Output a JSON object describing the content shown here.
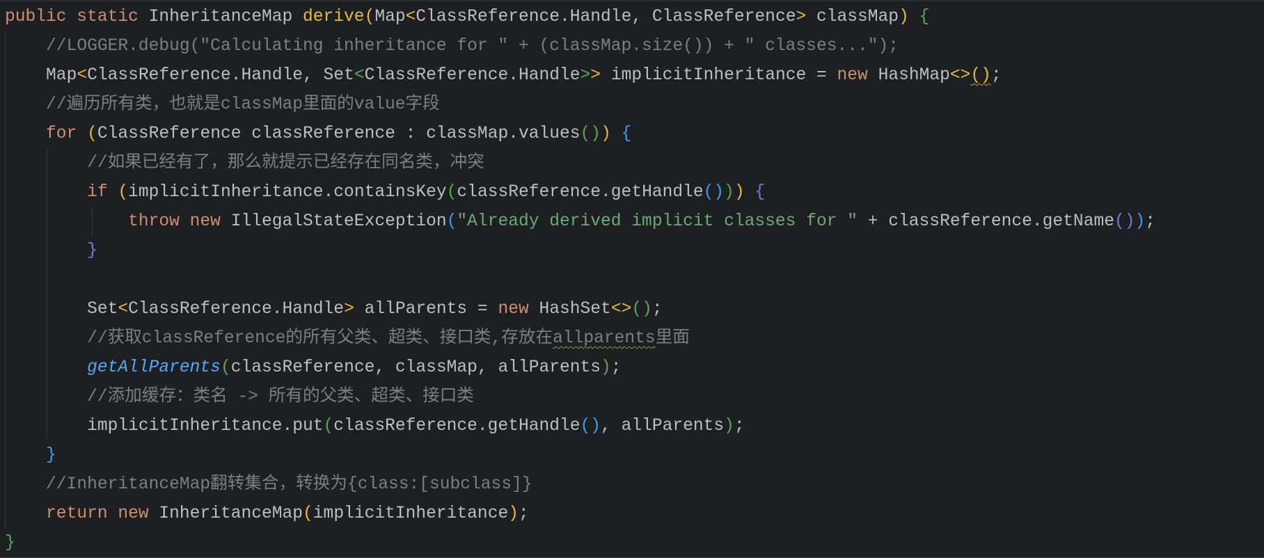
{
  "editor": {
    "language": "Java",
    "lines": [
      [
        [
          "kw",
          "public static "
        ],
        [
          "cls",
          "InheritanceMap "
        ],
        [
          "p1fn",
          "derive"
        ],
        [
          "p1",
          "("
        ],
        [
          "cls",
          "Map"
        ],
        [
          "p1",
          "<"
        ],
        [
          "cls",
          "ClassReference.Handle, ClassReference"
        ],
        [
          "p1",
          ">"
        ],
        [
          "cls",
          " classMap"
        ],
        [
          "p1",
          ")"
        ],
        [
          "cls",
          " "
        ],
        [
          "p2",
          "{"
        ]
      ],
      [
        [
          "ind1",
          ""
        ],
        [
          "cm",
          "//LOGGER.debug(\"Calculating inheritance for \" + (classMap.size()) + \" classes...\");"
        ]
      ],
      [
        [
          "ind1",
          ""
        ],
        [
          "cls",
          "Map"
        ],
        [
          "p1",
          "<"
        ],
        [
          "cls",
          "ClassReference.Handle, Set"
        ],
        [
          "p2",
          "<"
        ],
        [
          "cls",
          "ClassReference.Handle"
        ],
        [
          "p2",
          ">"
        ],
        [
          "p1",
          ">"
        ],
        [
          "cls",
          " implicitInheritance = "
        ],
        [
          "kw",
          "new "
        ],
        [
          "cls",
          "HashMap"
        ],
        [
          "p1",
          "<>"
        ],
        [
          "sq",
          "()"
        ],
        [
          "cls",
          ";"
        ]
      ],
      [
        [
          "ind1",
          ""
        ],
        [
          "cm",
          "//遍历所有类，也就是classMap里面的value字段"
        ]
      ],
      [
        [
          "ind1",
          ""
        ],
        [
          "kw",
          "for "
        ],
        [
          "p1",
          "("
        ],
        [
          "cls",
          "ClassReference classReference : classMap.values"
        ],
        [
          "p2",
          "()"
        ],
        [
          "p1",
          ")"
        ],
        [
          "cls",
          " "
        ],
        [
          "p3",
          "{"
        ]
      ],
      [
        [
          "ind2",
          ""
        ],
        [
          "cm",
          "//如果已经有了，那么就提示已经存在同名类，冲突"
        ]
      ],
      [
        [
          "ind2",
          ""
        ],
        [
          "kw",
          "if "
        ],
        [
          "p1",
          "("
        ],
        [
          "cls",
          "implicitInheritance.containsKey"
        ],
        [
          "p2",
          "("
        ],
        [
          "cls",
          "classReference.getHandle"
        ],
        [
          "p3",
          "()"
        ],
        [
          "p2",
          ")"
        ],
        [
          "p1",
          ")"
        ],
        [
          "cls",
          " "
        ],
        [
          "p4",
          "{"
        ]
      ],
      [
        [
          "ind3",
          ""
        ],
        [
          "kw",
          "throw new "
        ],
        [
          "cls",
          "IllegalStateException"
        ],
        [
          "p3",
          "("
        ],
        [
          "str",
          "\"Already derived implicit classes for \""
        ],
        [
          "cls",
          " + classReference.getName"
        ],
        [
          "p4",
          "()"
        ],
        [
          "p3",
          ")"
        ],
        [
          "cls",
          ";"
        ]
      ],
      [
        [
          "ind2",
          ""
        ],
        [
          "p4",
          "}"
        ]
      ],
      [],
      [
        [
          "ind2",
          ""
        ],
        [
          "cls",
          "Set"
        ],
        [
          "p1",
          "<"
        ],
        [
          "cls",
          "ClassReference.Handle"
        ],
        [
          "p1",
          ">"
        ],
        [
          "cls",
          " allParents = "
        ],
        [
          "kw",
          "new "
        ],
        [
          "cls",
          "HashSet"
        ],
        [
          "p1",
          "<>"
        ],
        [
          "p2",
          "()"
        ],
        [
          "cls",
          ";"
        ]
      ],
      [
        [
          "ind2",
          ""
        ],
        [
          "cm",
          "//获取classReference的所有父类、超类、接口类,存放在"
        ],
        [
          "cmsq",
          "allparents"
        ],
        [
          "cm",
          "里面"
        ]
      ],
      [
        [
          "ind2",
          ""
        ],
        [
          "it",
          "getAllParents"
        ],
        [
          "p2",
          "("
        ],
        [
          "cls",
          "classReference, classMap, allParents"
        ],
        [
          "p2",
          ")"
        ],
        [
          "cls",
          ";"
        ]
      ],
      [
        [
          "ind2",
          ""
        ],
        [
          "cm",
          "//添加缓存：类名 -> 所有的父类、超类、接口类"
        ]
      ],
      [
        [
          "ind2",
          ""
        ],
        [
          "cls",
          "implicitInheritance.put"
        ],
        [
          "p2",
          "("
        ],
        [
          "cls",
          "classReference.getHandle"
        ],
        [
          "p3",
          "()"
        ],
        [
          "cls",
          ", allParents"
        ],
        [
          "p2",
          ")"
        ],
        [
          "cls",
          ";"
        ]
      ],
      [
        [
          "ind1",
          ""
        ],
        [
          "p3",
          "}"
        ]
      ],
      [
        [
          "ind1",
          ""
        ],
        [
          "cm",
          "//InheritanceMap翻转集合，转换为{class:[subclass]}"
        ]
      ],
      [
        [
          "ind1",
          ""
        ],
        [
          "kw",
          "return new "
        ],
        [
          "cls",
          "InheritanceMap"
        ],
        [
          "p1",
          "("
        ],
        [
          "cls",
          "implicitInheritance"
        ],
        [
          "p1",
          ")"
        ],
        [
          "cls",
          ";"
        ]
      ],
      [
        [
          "p2",
          "}"
        ]
      ]
    ]
  },
  "colors": {
    "background": "#1e1f22",
    "keyword": "#cf8e6d",
    "function": "#56a8f5",
    "string": "#6aab73",
    "comment": "#7a7e85",
    "text": "#bcbec4",
    "bracket_level1": "#e8ba36",
    "bracket_level2": "#54a857",
    "bracket_level3": "#359ff4",
    "bracket_level4": "#6e7ed9"
  }
}
